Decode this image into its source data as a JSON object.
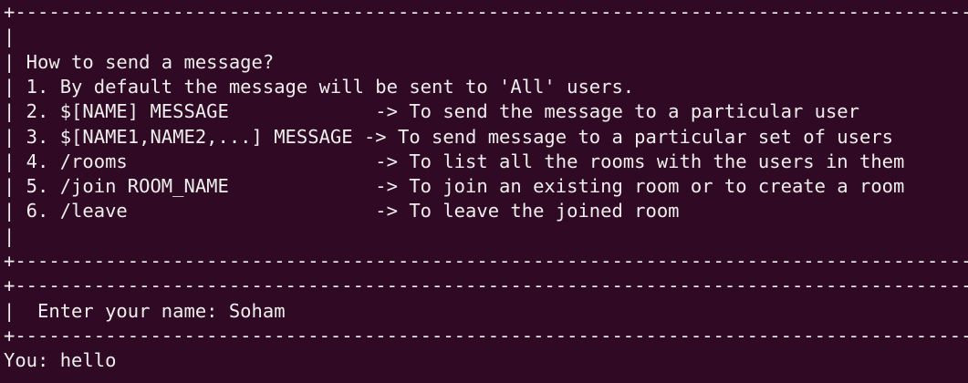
{
  "terminal": {
    "lines": [
      "+-------------------------------------------------------------------------------------------------------------------------+",
      "|",
      "| How to send a message?",
      "| 1. By default the message will be sent to 'All' users.",
      "| 2. $[NAME] MESSAGE             -> To send the message to a particular user",
      "| 3. $[NAME1,NAME2,...] MESSAGE -> To send message to a particular set of users",
      "| 4. /rooms                      -> To list all the rooms with the users in them",
      "| 5. /join ROOM_NAME             -> To join an existing room or to create a room",
      "| 6. /leave                      -> To leave the joined room",
      "|",
      "+-------------------------------------------------------------------------------------------------------------------------+",
      "+-------------------------------------------------------------------------------------------------------------------------+",
      "|  Enter your name: Soham",
      "+-------------------------------------------------------------------------------------------------------------------------+",
      "You: hello"
    ]
  }
}
